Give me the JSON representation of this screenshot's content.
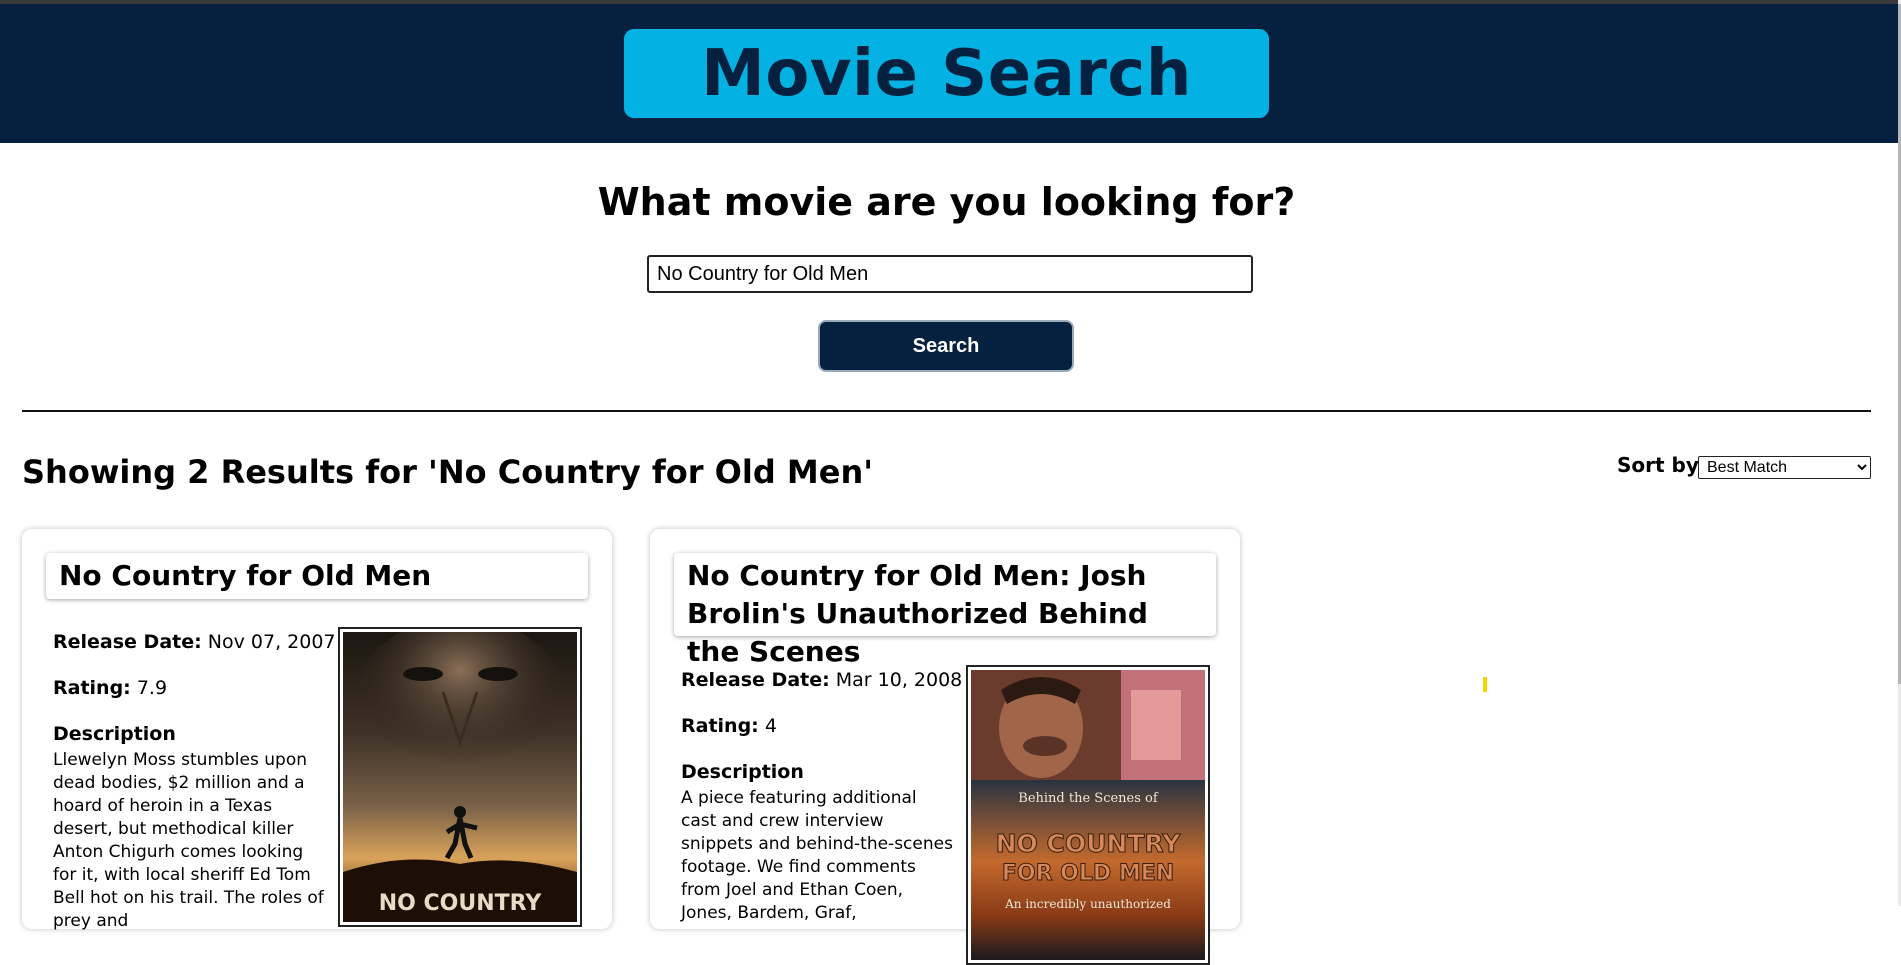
{
  "header": {
    "title": "Movie Search"
  },
  "search": {
    "question": "What movie are you looking for?",
    "value": "No Country for Old Men",
    "button_label": "Search"
  },
  "results": {
    "heading": "Showing 2 Results for 'No Country for Old Men'",
    "sort_label": "Sort by:",
    "sort_selected": "Best Match",
    "items": [
      {
        "title": "No Country for Old Men",
        "release_label": "Release Date:",
        "release_date": "Nov 07, 2007",
        "rating_label": "Rating:",
        "rating": "7.9",
        "description_label": "Description",
        "description": "Llewelyn Moss stumbles upon dead bodies, $2 million and a hoard of heroin in a Texas desert, but methodical killer Anton Chigurh comes looking for it, with local sheriff Ed Tom Bell hot on his trail. The roles of prey and",
        "poster_text": "NO COUNTRY"
      },
      {
        "title": "No Country for Old Men: Josh Brolin's Unauthorized Behind the Scenes",
        "release_label": "Release Date:",
        "release_date": "Mar 10, 2008",
        "rating_label": "Rating:",
        "rating": "4",
        "description_label": "Description",
        "description": "A piece featuring additional cast and crew interview snippets and behind-the-scenes footage. We find comments from Joel and Ethan Coen, Jones, Bardem, Graf,",
        "poster_top_text": "Behind the Scenes of",
        "poster_title_1": "NO COUNTRY",
        "poster_title_2": "FOR OLD MEN",
        "poster_bottom_text": "An incredibly unauthorized"
      }
    ]
  },
  "colors": {
    "header_bg": "#05213f",
    "title_box": "#03b2e2",
    "button_bg": "#05213f"
  }
}
